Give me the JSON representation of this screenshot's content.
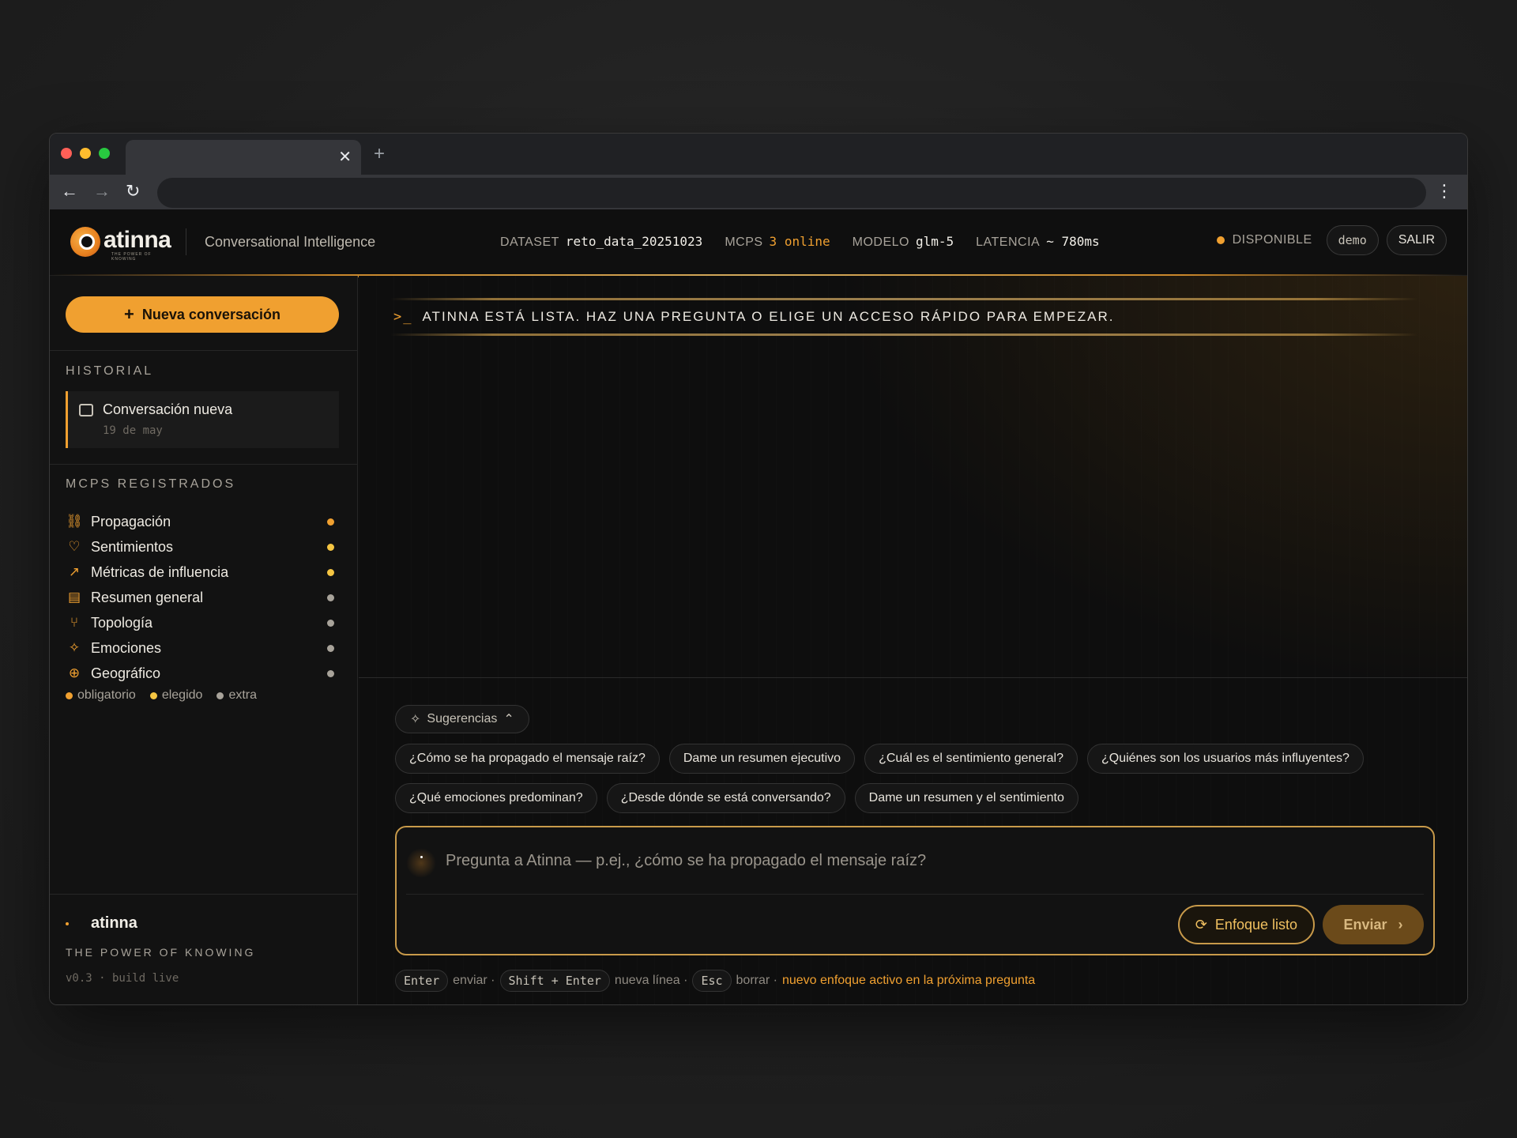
{
  "browser": {
    "tab_close": "✕",
    "tab_new": "+",
    "back": "←",
    "forward": "→",
    "reload": "↻",
    "menu": "⋮"
  },
  "header": {
    "logo_text": "atinna",
    "logo_sub": "THE POWER OF KNOWING",
    "product": "Conversational Intelligence",
    "stats": {
      "dataset_label": "DATASET",
      "dataset_value": "reto_data_20251023",
      "mcps_label": "MCPS",
      "mcps_value": "3 online",
      "model_label": "MODELO",
      "model_value": "glm-5",
      "latency_label": "LATENCIA",
      "latency_value": "~ 780ms"
    },
    "status": "DISPONIBLE",
    "user": "demo",
    "logout": "SALIR"
  },
  "sidebar": {
    "new_chat": "Nueva conversación",
    "history_title": "HISTORIAL",
    "history": [
      {
        "title": "Conversación nueva",
        "date": "19 de may"
      }
    ],
    "mcps_title": "MCPS REGISTRADOS",
    "mcps": [
      {
        "label": "Propagación",
        "icon": "⛓",
        "status": "obligatorio"
      },
      {
        "label": "Sentimientos",
        "icon": "♡",
        "status": "elegido"
      },
      {
        "label": "Métricas de influencia",
        "icon": "↗",
        "status": "elegido"
      },
      {
        "label": "Resumen general",
        "icon": "▤",
        "status": "extra"
      },
      {
        "label": "Topología",
        "icon": "⑂",
        "status": "extra"
      },
      {
        "label": "Emociones",
        "icon": "✧",
        "status": "extra"
      },
      {
        "label": "Geográfico",
        "icon": "⊕",
        "status": "extra"
      }
    ],
    "legend": {
      "required": "obligatorio",
      "chosen": "elegido",
      "extra": "extra"
    },
    "footer": {
      "name": "atinna",
      "tagline": "THE POWER OF KNOWING",
      "version": "v0.3 · build live"
    }
  },
  "main": {
    "banner_prompt": ">_",
    "banner": "ATINNA ESTÁ LISTA. HAZ UNA PREGUNTA O ELIGE UN ACCESO RÁPIDO PARA EMPEZAR.",
    "suggestions_label": "Sugerencias",
    "suggestions": [
      "¿Cómo se ha propagado el mensaje raíz?",
      "Dame un resumen ejecutivo",
      "¿Cuál es el sentimiento general?",
      "¿Quiénes son los usuarios más influyentes?",
      "¿Qué emociones predominan?",
      "¿Desde dónde se está conversando?",
      "Dame un resumen y el sentimiento"
    ],
    "input_placeholder": "Pregunta a Atinna — p.ej., ¿cómo se ha propagado el mensaje raíz?",
    "focus_button": "Enfoque listo",
    "send_button": "Enviar",
    "hints": {
      "enter_key": "Enter",
      "enter_action": "enviar ·",
      "shift_key": "Shift + Enter",
      "shift_action": "nueva línea ·",
      "esc_key": "Esc",
      "esc_action": "borrar ·",
      "note": "nuevo enfoque activo en la próxima pregunta"
    }
  },
  "colors": {
    "accent": "#f0a030",
    "required": "#f0a030",
    "chosen": "#f5c542",
    "extra": "#a8a39a"
  }
}
